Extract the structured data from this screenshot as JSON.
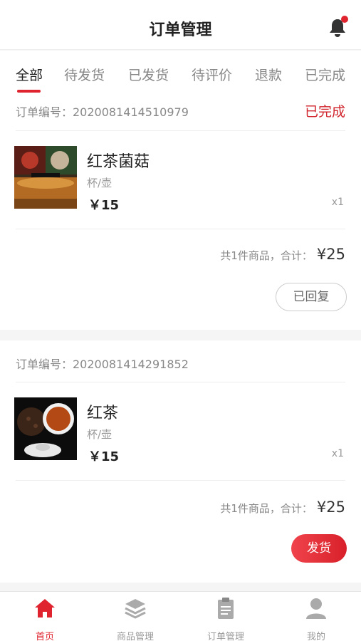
{
  "header": {
    "title": "订单管理",
    "has_notification": true
  },
  "tabs": [
    {
      "label": "全部",
      "active": true
    },
    {
      "label": "待发货"
    },
    {
      "label": "已发货"
    },
    {
      "label": "待评价"
    },
    {
      "label": "退款"
    },
    {
      "label": "已完成"
    }
  ],
  "orders": [
    {
      "order_no": "订单编号：2020081414510979",
      "status": "已完成",
      "product": {
        "name": "红茶菌菇",
        "spec": "杯/壶",
        "price": "￥15",
        "qty": "x1"
      },
      "summary": {
        "count": "共1件商品，合计：",
        "total": "¥25"
      },
      "action": "已回复"
    },
    {
      "order_no": "订单编号：2020081414291852",
      "status": "",
      "product": {
        "name": "红茶",
        "spec": "杯/壶",
        "price": "￥15",
        "qty": "x1"
      },
      "summary": {
        "count": "共1件商品，合计：",
        "total": "¥25"
      },
      "action": "发货"
    }
  ],
  "bottom_nav": [
    {
      "label": "首页",
      "icon": "home-icon",
      "active": true
    },
    {
      "label": "商品管理",
      "icon": "layers-icon"
    },
    {
      "label": "订单管理",
      "icon": "clipboard-icon"
    },
    {
      "label": "我的",
      "icon": "user-icon"
    }
  ],
  "colors": {
    "accent": "#e0242f",
    "status_done": "#d0232b",
    "text_muted": "#999999"
  }
}
